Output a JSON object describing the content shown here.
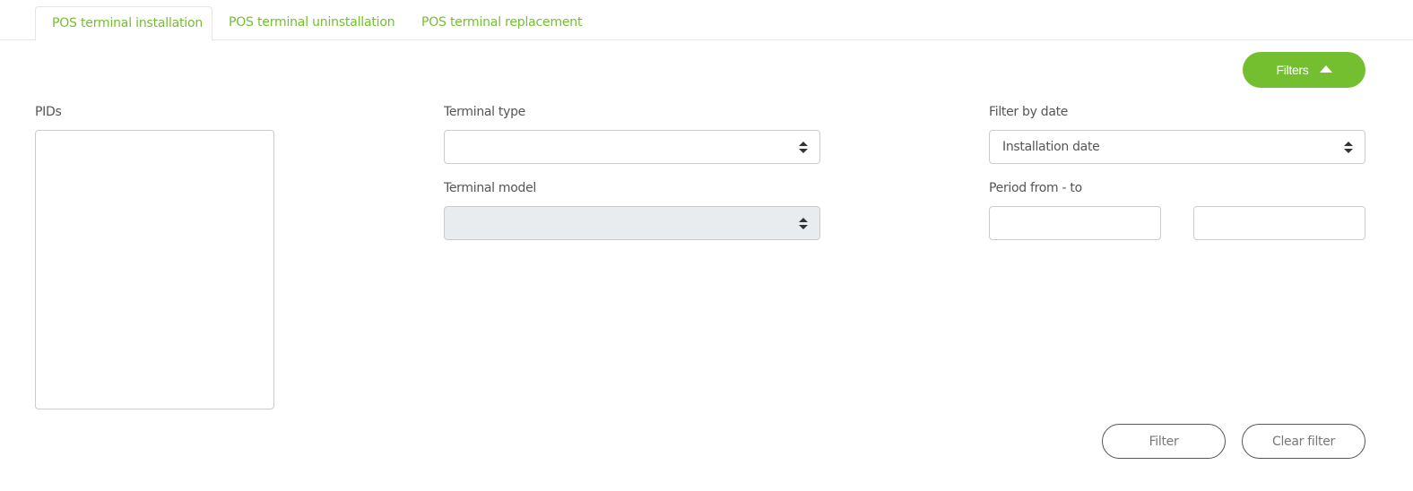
{
  "tabs": [
    {
      "label": "POS terminal installation",
      "active": true
    },
    {
      "label": "POS terminal uninstallation",
      "active": false
    },
    {
      "label": "POS terminal replacement",
      "active": false
    }
  ],
  "filters_toggle": {
    "label": "Filters",
    "icon": "caret-up-icon",
    "expanded": true
  },
  "form": {
    "pids": {
      "label": "PIDs",
      "value": ""
    },
    "terminal_type": {
      "label": "Terminal type",
      "value": "",
      "disabled": false
    },
    "terminal_model": {
      "label": "Terminal model",
      "value": "",
      "disabled": true
    },
    "filter_by_date": {
      "label": "Filter by date",
      "value": "Installation date"
    },
    "period": {
      "label": "Period from - to",
      "from": "",
      "to": ""
    }
  },
  "actions": {
    "filter_label": "Filter",
    "clear_label": "Clear filter"
  },
  "colors": {
    "accent": "#74bf2f",
    "disabled_bg": "#e9ecef",
    "border": "#cccccc"
  }
}
